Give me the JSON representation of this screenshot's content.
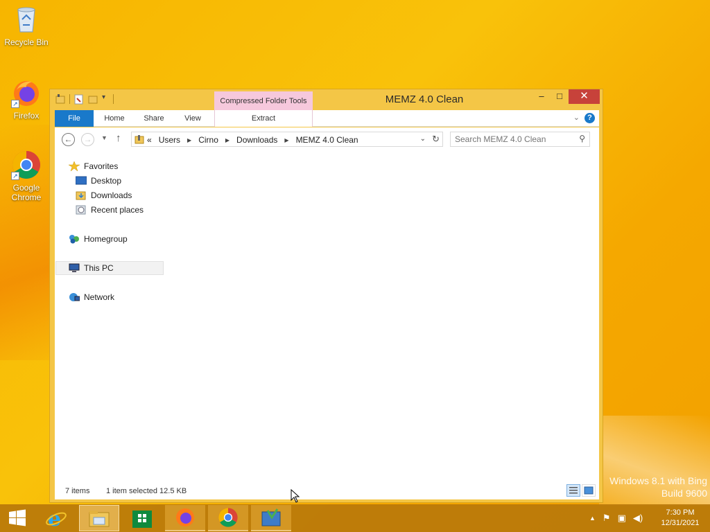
{
  "desktop": {
    "icons": [
      {
        "label": "Recycle Bin",
        "icon": "recycle-bin-icon"
      },
      {
        "label": "Firefox",
        "icon": "firefox-icon"
      },
      {
        "label": "Google Chrome",
        "icon": "chrome-icon"
      }
    ],
    "watermark": {
      "line1": "Windows 8.1 with Bing",
      "line2": "Build 9600"
    }
  },
  "window": {
    "title": "MEMZ 4.0 Clean",
    "context_tab": "Compressed Folder Tools",
    "min_label": "–",
    "max_label": "□",
    "close_label": "✕",
    "ribbon": {
      "tabs": [
        "File",
        "Home",
        "Share",
        "View",
        "Extract"
      ],
      "help": "?"
    },
    "address": {
      "crumbs": [
        "Users",
        "Cirno",
        "Downloads",
        "MEMZ 4.0 Clean"
      ],
      "prefix": "«"
    },
    "search": {
      "placeholder": "Search MEMZ 4.0 Clean"
    },
    "nav": {
      "favorites": "Favorites",
      "desktop": "Desktop",
      "downloads": "Downloads",
      "recent": "Recent places",
      "homegroup": "Homegroup",
      "thispc": "This PC",
      "network": "Network"
    },
    "status": {
      "items": "7 items",
      "selected": "1 item selected  12.5 KB"
    }
  },
  "taskbar": {
    "time": "7:30 PM",
    "date": "12/31/2021",
    "apps": [
      "start-icon",
      "internet-explorer-icon",
      "file-explorer-icon",
      "store-icon",
      "firefox-icon",
      "chrome-icon",
      "installer-icon"
    ]
  },
  "colors": {
    "accent": "#1979ca",
    "close": "#c7423a",
    "context_tab": "#f6c8dc",
    "window_frame": "#f4c646"
  }
}
